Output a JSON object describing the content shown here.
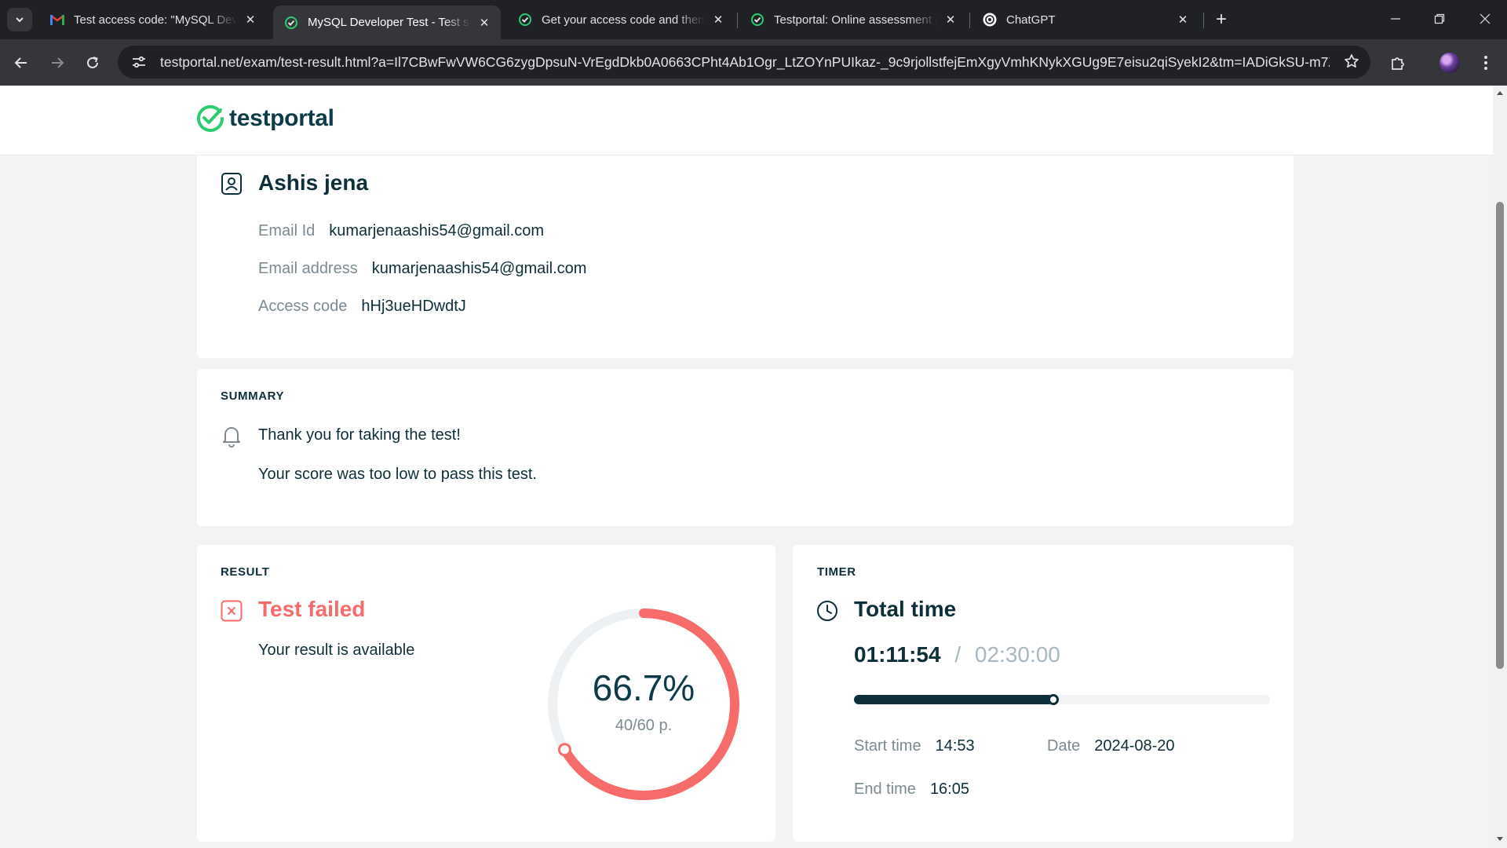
{
  "browser": {
    "tabs": [
      {
        "title": "Test access code: \"MySQL Developer Test\"",
        "favicon": "gmail-icon"
      },
      {
        "title": "MySQL Developer Test - Test summary",
        "favicon": "testportal-icon",
        "active": true
      },
      {
        "title": "Get your access code and then start the test",
        "favicon": "testportal-icon"
      },
      {
        "title": "Testportal: Online assessment platform",
        "favicon": "testportal-icon"
      },
      {
        "title": "ChatGPT",
        "favicon": "chatgpt-icon"
      }
    ],
    "url": "testportal.net/exam/test-result.html?a=Il7CBwFwVW6CG6zygDpsuN-VrEgdDkb0A0663CPht4Ab1Ogr_LtZOYnPUIkaz-_9c9rjollstfejEmXgyVmhKNykXGUg9E7eisu2qiSyekI2&tm=IADiGkSU-m7ZbQ..."
  },
  "site": {
    "logo_text": "testportal",
    "brand_color": "#2ecc71",
    "dark_color": "#0d3b47"
  },
  "profile": {
    "name": "Ashis jena",
    "fields": [
      {
        "label": "Email Id",
        "value": "kumarjenaashis54@gmail.com"
      },
      {
        "label": "Email address",
        "value": "kumarjenaashis54@gmail.com"
      },
      {
        "label": "Access code",
        "value": "hHj3ueHDwdtJ"
      }
    ]
  },
  "summary": {
    "label": "SUMMARY",
    "line1": "Thank you for taking the test!",
    "line2": "Your score was too low to pass this test."
  },
  "result": {
    "label": "RESULT",
    "status": "Test failed",
    "status_color": "#f76b6b",
    "note": "Your result is available",
    "percent_text": "66.7%",
    "percent": 66.7,
    "points_text": "40/60 p."
  },
  "timer": {
    "label": "TIMER",
    "title": "Total time",
    "elapsed": "01:11:54",
    "separator": "/",
    "limit": "02:30:00",
    "progress": 0.479,
    "start_label": "Start time",
    "start_value": "14:53",
    "date_label": "Date",
    "date_value": "2024-08-20",
    "end_label": "End time",
    "end_value": "16:05"
  }
}
